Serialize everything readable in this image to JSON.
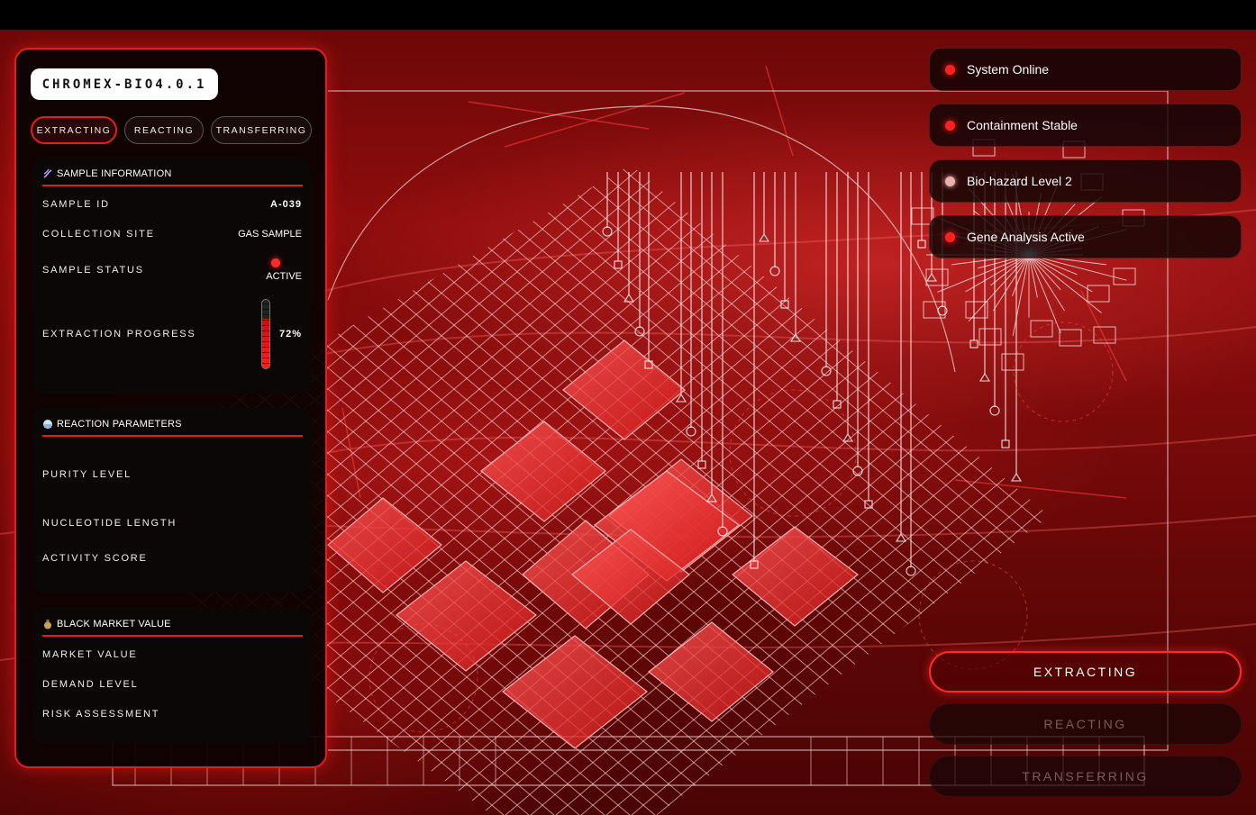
{
  "app": {
    "logo": "CHROMEX-BIO4.0.1"
  },
  "tabs": [
    "EXTRACTING",
    "REACTING",
    "TRANSFERRING"
  ],
  "sample_info": {
    "title": "SAMPLE INFORMATION",
    "icon": "dna-icon",
    "rows": {
      "sample_id_label": "SAMPLE ID",
      "sample_id_value": "A-039",
      "collection_site_label": "COLLECTION SITE",
      "collection_site_value": "GAS SAMPLE",
      "sample_status_label": "SAMPLE STATUS",
      "sample_status_value": "ACTIVE",
      "extraction_progress_label": "EXTRACTION PROGRESS",
      "extraction_progress_value": "72%",
      "extraction_progress_fraction": 0.72
    }
  },
  "reaction": {
    "title": "REACTION PARAMETERS",
    "icon": "beaker-icon",
    "rows": {
      "purity_label": "PURITY LEVEL",
      "nucleotide_label": "NUCLEOTIDE LENGTH",
      "activity_label": "ACTIVITY SCORE"
    }
  },
  "market": {
    "title": "BLACK MARKET VALUE",
    "icon": "money-bag-icon",
    "rows": {
      "market_value_label": "MARKET VALUE",
      "demand_label": "DEMAND LEVEL",
      "risk_label": "RISK ASSESSMENT"
    }
  },
  "status_list": [
    {
      "text": "System Online"
    },
    {
      "text": "Containment Stable"
    },
    {
      "text": "Bio-hazard Level 2"
    },
    {
      "text": "Gene Analysis Active"
    }
  ],
  "actions": {
    "extracting": "EXTRACTING",
    "reacting": "REACTING",
    "transferring": "TRANSFERRING"
  },
  "colors": {
    "accent": "#e0201e",
    "background": "#7a0a0a",
    "status_ok": "#2ecc40"
  }
}
